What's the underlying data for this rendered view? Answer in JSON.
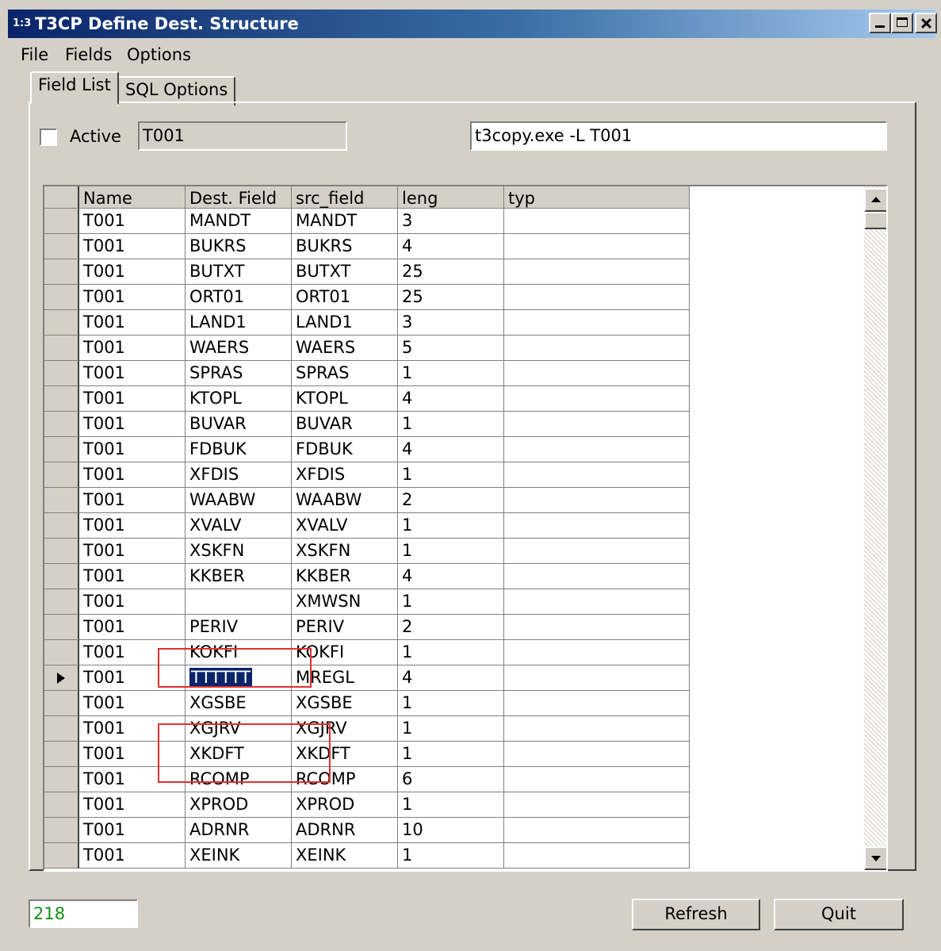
{
  "window": {
    "icon_text": "1:3",
    "title": "T3CP  Define Dest. Structure"
  },
  "menu": [
    "File",
    "Fields",
    "Options"
  ],
  "tabs": [
    "Field List",
    "SQL Options"
  ],
  "form": {
    "active_label": "Active",
    "active_checked": false,
    "table_name": "T001",
    "command": "t3copy.exe -L T001"
  },
  "grid": {
    "columns": [
      "Name",
      "Dest. Field",
      "src_field",
      "leng",
      "typ"
    ],
    "current_row_index": 18,
    "rows": [
      [
        "T001",
        "MANDT",
        "MANDT",
        "3",
        ""
      ],
      [
        "T001",
        "BUKRS",
        "BUKRS",
        "4",
        ""
      ],
      [
        "T001",
        "BUTXT",
        "BUTXT",
        "25",
        ""
      ],
      [
        "T001",
        "ORT01",
        "ORT01",
        "25",
        ""
      ],
      [
        "T001",
        "LAND1",
        "LAND1",
        "3",
        ""
      ],
      [
        "T001",
        "WAERS",
        "WAERS",
        "5",
        ""
      ],
      [
        "T001",
        "SPRAS",
        "SPRAS",
        "1",
        ""
      ],
      [
        "T001",
        "KTOPL",
        "KTOPL",
        "4",
        ""
      ],
      [
        "T001",
        "BUVAR",
        "BUVAR",
        "1",
        ""
      ],
      [
        "T001",
        "FDBUK",
        "FDBUK",
        "4",
        ""
      ],
      [
        "T001",
        "XFDIS",
        "XFDIS",
        "1",
        ""
      ],
      [
        "T001",
        "WAABW",
        "WAABW",
        "2",
        ""
      ],
      [
        "T001",
        "XVALV",
        "XVALV",
        "1",
        ""
      ],
      [
        "T001",
        "XSKFN",
        "XSKFN",
        "1",
        ""
      ],
      [
        "T001",
        "KKBER",
        "KKBER",
        "4",
        ""
      ],
      [
        "T001",
        "",
        "XMWSN",
        "1",
        ""
      ],
      [
        "T001",
        "PERIV",
        "PERIV",
        "2",
        ""
      ],
      [
        "T001",
        "KOKFI",
        "KOKFI",
        "1",
        ""
      ],
      [
        "T001",
        "TTTTTT",
        "MREGL",
        "4",
        ""
      ],
      [
        "T001",
        "XGSBE",
        "XGSBE",
        "1",
        ""
      ],
      [
        "T001",
        "XGJRV",
        "XGJRV",
        "1",
        ""
      ],
      [
        "T001",
        "XKDFT",
        "XKDFT",
        "1",
        ""
      ],
      [
        "T001",
        "RCOMP",
        "RCOMP",
        "6",
        ""
      ],
      [
        "T001",
        "XPROD",
        "XPROD",
        "1",
        ""
      ],
      [
        "T001",
        "ADRNR",
        "ADRNR",
        "10",
        ""
      ],
      [
        "T001",
        "XEINK",
        "XEINK",
        "1",
        ""
      ]
    ]
  },
  "status": {
    "record_count": "218"
  },
  "buttons": {
    "refresh": "Refresh",
    "quit": "Quit"
  },
  "colors": {
    "title_bar": "#0a246a",
    "selection": "#0a246a",
    "annotation_box": "#e03030",
    "record_count_text": "#109010"
  }
}
